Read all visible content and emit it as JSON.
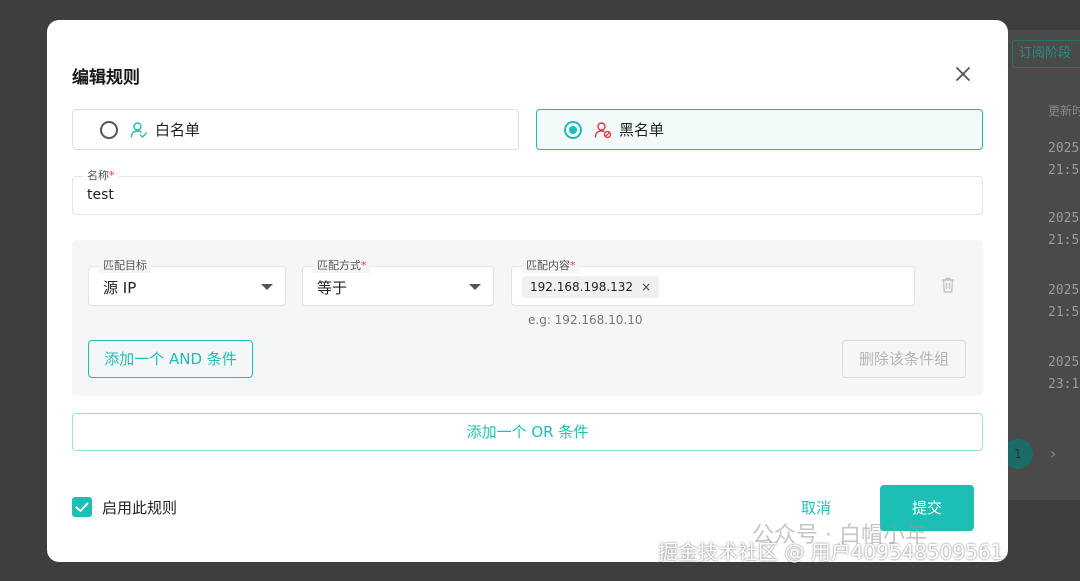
{
  "background": {
    "tab_label": "订阅阶段",
    "column_header": "更新时",
    "dates": [
      {
        "line1": "2025",
        "line2": "21:5"
      },
      {
        "line1": "2025",
        "line2": "21:5"
      },
      {
        "line1": "2025",
        "line2": "21:5"
      },
      {
        "line1": "2025",
        "line2": "23:1"
      }
    ],
    "page_number": "1",
    "next_symbol": "›"
  },
  "modal": {
    "title": "编辑规则",
    "rule_types": {
      "whitelist": {
        "label": "白名单",
        "selected": false
      },
      "blacklist": {
        "label": "黑名单",
        "selected": true
      }
    },
    "name_field": {
      "label": "名称",
      "required_mark": "*",
      "value": "test"
    },
    "condition_group": {
      "target": {
        "label": "匹配目标",
        "value": "源 IP"
      },
      "method": {
        "label": "匹配方式",
        "required_mark": "*",
        "value": "等于"
      },
      "content": {
        "label": "匹配内容",
        "required_mark": "*",
        "tags": [
          {
            "text": "192.168.198.132",
            "remove": "×"
          }
        ],
        "helper": "e.g: 192.168.10.10"
      },
      "add_and_label": "添加一个 AND 条件",
      "delete_group_label": "删除该条件组"
    },
    "add_or_label": "添加一个 OR 条件",
    "enable_rule": {
      "label": "启用此规则",
      "checked": true
    },
    "cancel_label": "取消",
    "submit_label": "提交"
  },
  "watermark": {
    "wechat": "公众号 · 白帽小年",
    "juejin": "掘金技术社区 @ 用户409548509561"
  },
  "colors": {
    "accent": "#1dbfb5",
    "required": "#e4393c"
  }
}
